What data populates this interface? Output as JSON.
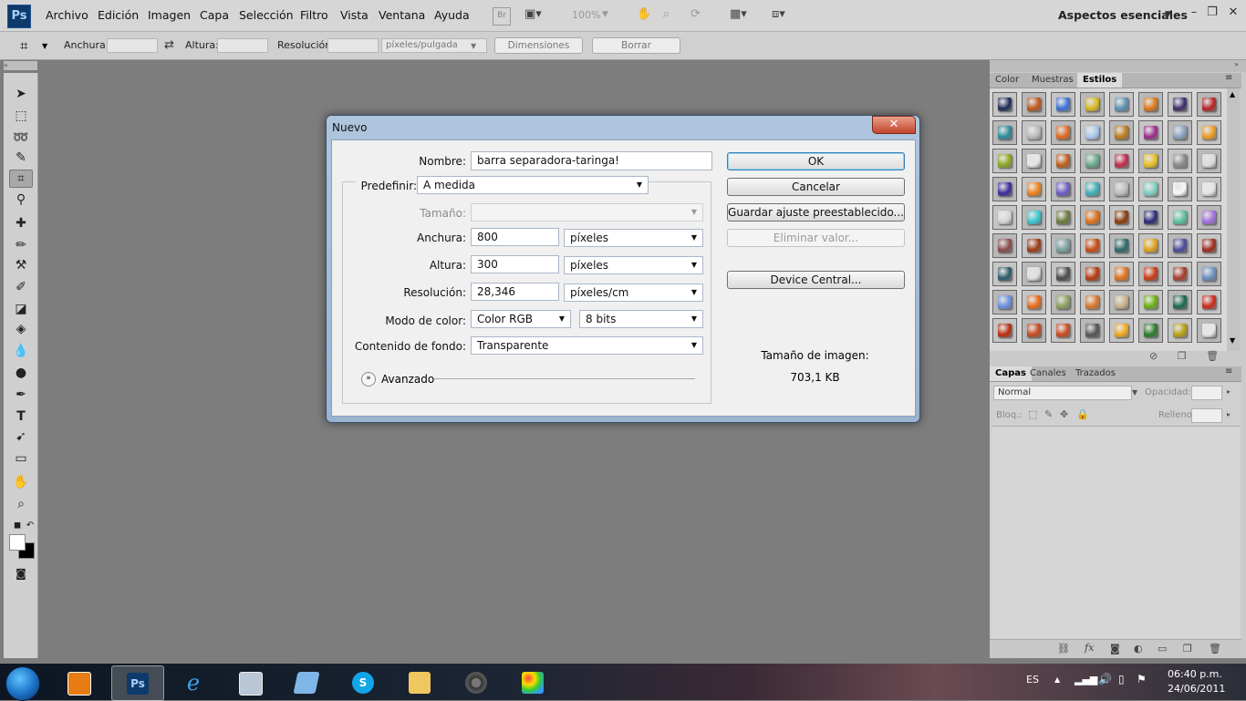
{
  "app": {
    "logo_text": "Ps",
    "menu": [
      "Archivo",
      "Edición",
      "Imagen",
      "Capa",
      "Selección",
      "Filtro",
      "Vista",
      "Ventana",
      "Ayuda"
    ],
    "zoom": "100%",
    "bridge_label": "Br",
    "workspace": "Aspectos esenciales"
  },
  "options_bar": {
    "width_label": "Anchura:",
    "height_label": "Altura:",
    "resolution_label": "Resolución:",
    "units": "píxeles/pulgada",
    "dimensions_button": "Dimensiones",
    "clear_button": "Borrar"
  },
  "styles_panel": {
    "tabs": [
      "Color",
      "Muestras",
      "Estilos"
    ],
    "active_tab": "Estilos"
  },
  "layers_panel": {
    "tabs": [
      "Capas",
      "Canales",
      "Trazados"
    ],
    "blend_mode": "Normal",
    "opacity_label": "Opacidad:",
    "lock_label": "Bloq.:",
    "fill_label": "Relleno:"
  },
  "dialog": {
    "title": "Nuevo",
    "name_label": "Nombre:",
    "name_value": "barra separadora-taringa!",
    "preset_label": "Predefinir:",
    "preset_value": "A medida",
    "size_label": "Tamaño:",
    "width_label": "Anchura:",
    "width_value": "800",
    "width_units": "píxeles",
    "height_label": "Altura:",
    "height_value": "300",
    "height_units": "píxeles",
    "resolution_label": "Resolución:",
    "resolution_value": "28,346",
    "resolution_units": "píxeles/cm",
    "color_mode_label": "Modo de color:",
    "color_mode_value": "Color RGB",
    "bit_depth": "8 bits",
    "background_label": "Contenido de fondo:",
    "background_value": "Transparente",
    "advanced_label": "Avanzado",
    "ok_button": "OK",
    "cancel_button": "Cancelar",
    "save_preset_button": "Guardar ajuste preestablecido...",
    "delete_preset_button": "Eliminar valor...",
    "device_central_button": "Device Central...",
    "image_size_label": "Tamaño de imagen:",
    "image_size_value": "703,1 KB"
  },
  "taskbar": {
    "language": "ES",
    "time": "06:40 p.m.",
    "date": "24/06/2011"
  },
  "colors": {
    "menubar_bg": "#d6d6d6",
    "canvas_bg": "#7d7d7d",
    "dialog_frame": "#aec5dd",
    "ps_logo_bg": "#0d3a6b"
  }
}
